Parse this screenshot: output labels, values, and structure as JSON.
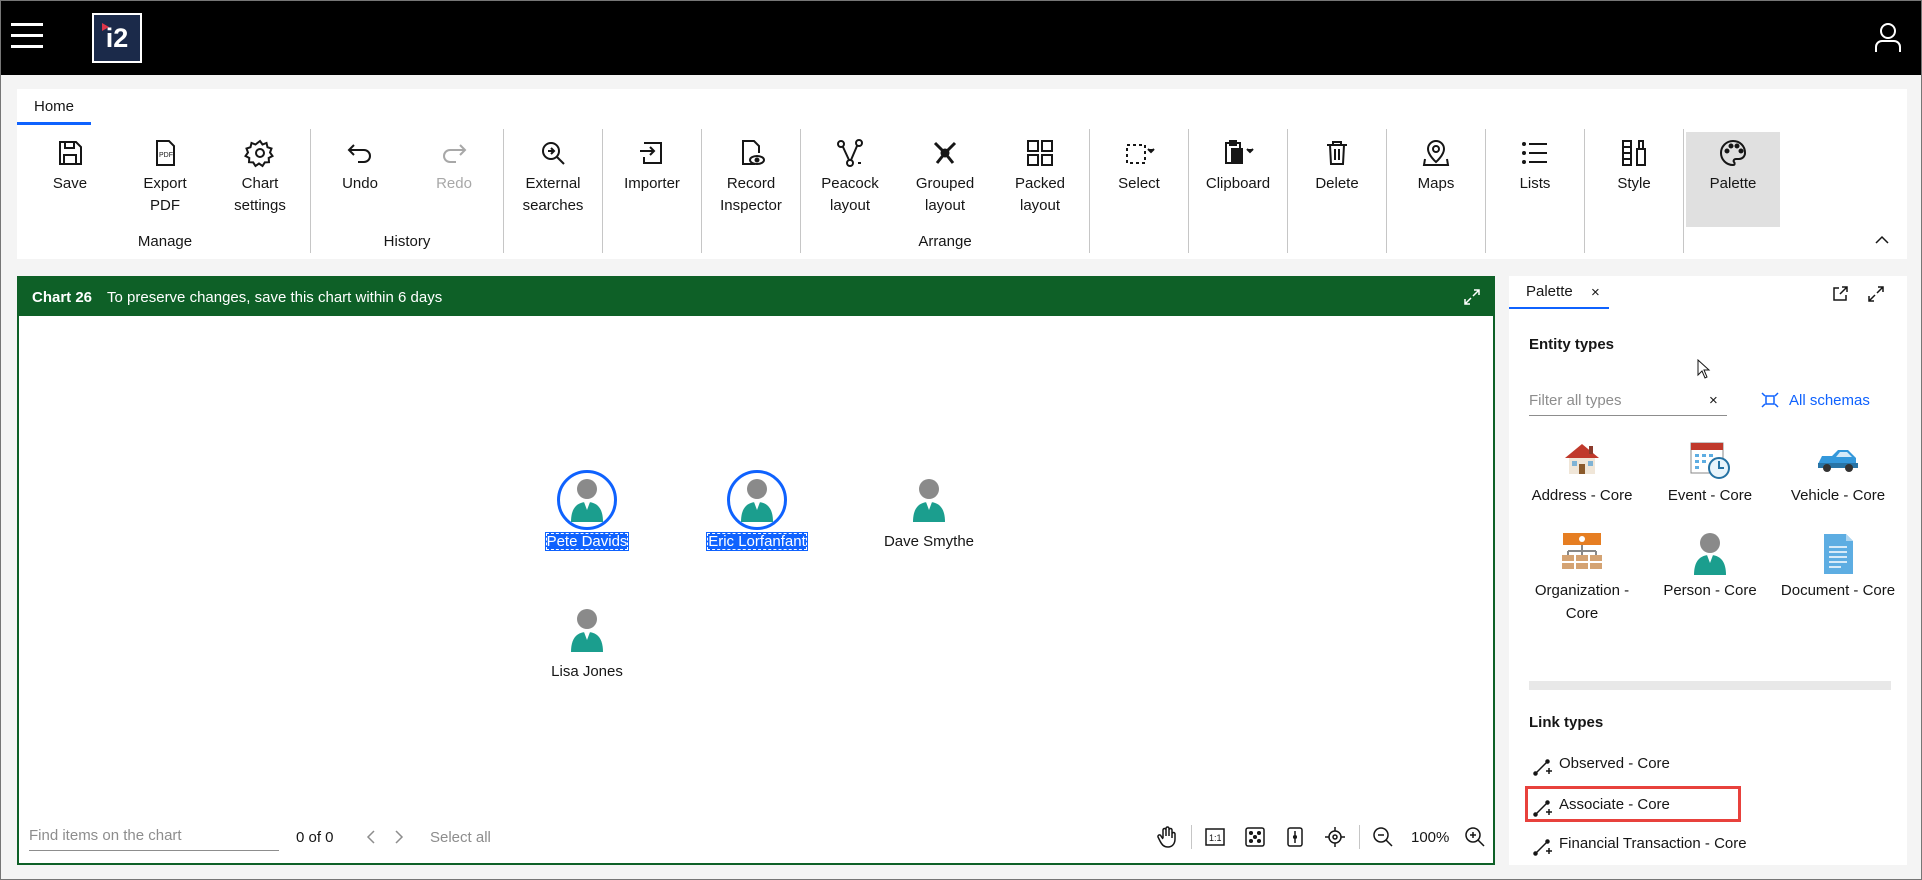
{
  "header": {
    "logo_text": "i2"
  },
  "ribbon": {
    "tab": "Home",
    "buttons": {
      "save": [
        "Save"
      ],
      "export": [
        "Export",
        "PDF"
      ],
      "chart_settings": [
        "Chart",
        "settings"
      ],
      "undo": [
        "Undo"
      ],
      "redo": [
        "Redo"
      ],
      "external": [
        "External",
        "searches"
      ],
      "importer": [
        "Importer"
      ],
      "record": [
        "Record",
        "Inspector"
      ],
      "peacock": [
        "Peacock",
        "layout"
      ],
      "grouped": [
        "Grouped",
        "layout"
      ],
      "packed": [
        "Packed",
        "layout"
      ],
      "select": [
        "Select"
      ],
      "clipboard": [
        "Clipboard"
      ],
      "delete": [
        "Delete"
      ],
      "maps": [
        "Maps"
      ],
      "lists": [
        "Lists"
      ],
      "style": [
        "Style"
      ],
      "palette": [
        "Palette"
      ]
    },
    "groups": {
      "manage": "Manage",
      "history": "History",
      "arrange": "Arrange"
    }
  },
  "chart": {
    "name": "Chart 26",
    "notice": "To preserve changes, save this chart within 6 days",
    "nodes": [
      {
        "label": "Pete Davids",
        "selected": true
      },
      {
        "label": "Eric Lorfanfant",
        "selected": true
      },
      {
        "label": "Dave Smythe",
        "selected": false
      },
      {
        "label": "Lisa Jones",
        "selected": false
      }
    ],
    "footer": {
      "find_placeholder": "Find items on the chart",
      "count": "0 of 0",
      "select_all": "Select all",
      "zoom": "100%"
    }
  },
  "palette": {
    "tab": "Palette",
    "entity_heading": "Entity types",
    "filter_placeholder": "Filter all types",
    "all_schemas": "All schemas",
    "entities": [
      {
        "label": "Address - Core",
        "icon": "house-icon"
      },
      {
        "label": "Event - Core",
        "icon": "calendar-icon"
      },
      {
        "label": "Vehicle - Core",
        "icon": "car-icon"
      },
      {
        "label": "Organization - Core",
        "icon": "org-chart-icon"
      },
      {
        "label": "Person - Core",
        "icon": "person-icon"
      },
      {
        "label": "Document - Core",
        "icon": "document-icon"
      }
    ],
    "link_heading": "Link types",
    "links": [
      {
        "label": "Observed - Core"
      },
      {
        "label": "Associate - Core"
      },
      {
        "label": "Financial Transaction - Core"
      }
    ]
  },
  "colors": {
    "accent": "#0f62fe",
    "chart_header": "#0e6027",
    "highlight": "#e8413c"
  }
}
